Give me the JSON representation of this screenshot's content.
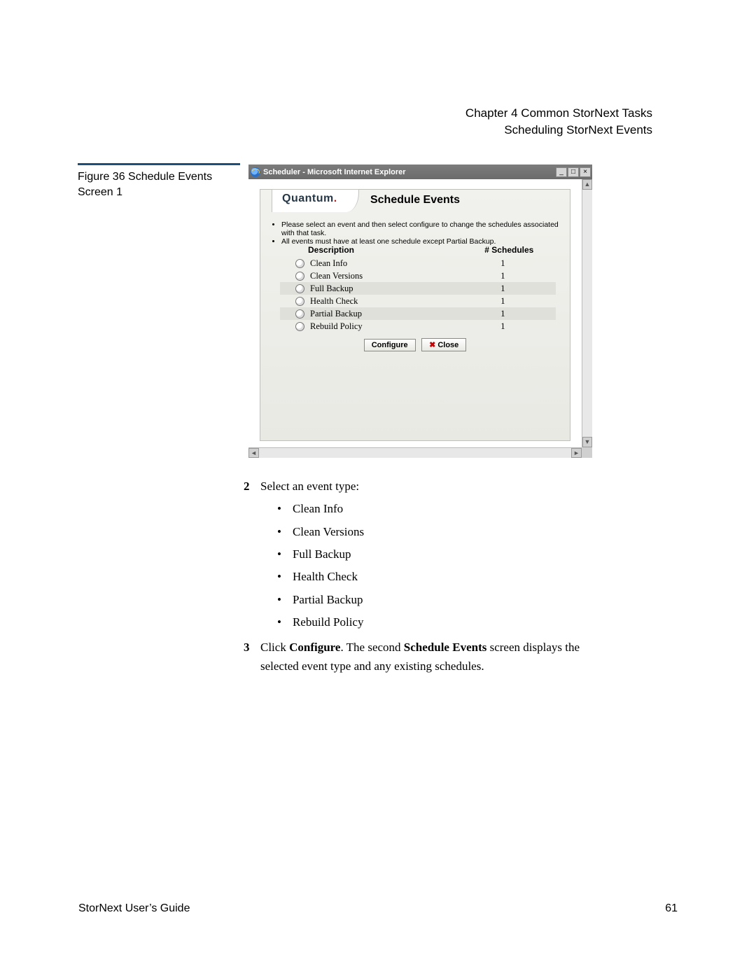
{
  "header": {
    "chapter": "Chapter 4  Common StorNext Tasks",
    "section": "Scheduling StorNext Events"
  },
  "figure": {
    "caption": "Figure 36  Schedule Events Screen 1"
  },
  "window": {
    "title": "Scheduler - Microsoft Internet Explorer",
    "buttons": {
      "min": "_",
      "max": "□",
      "close": "×"
    }
  },
  "scheduler": {
    "brand": "Quantum",
    "panel_title": "Schedule Events",
    "notes": [
      "Please select an event and then select configure to change the schedules associated with that task.",
      "All events must have at least one schedule except Partial Backup."
    ],
    "columns": {
      "description": "Description",
      "count": "# Schedules"
    },
    "rows": [
      {
        "label": "Clean Info",
        "count": "1",
        "alt": false
      },
      {
        "label": "Clean Versions",
        "count": "1",
        "alt": false
      },
      {
        "label": "Full Backup",
        "count": "1",
        "alt": true
      },
      {
        "label": "Health Check",
        "count": "1",
        "alt": false
      },
      {
        "label": "Partial Backup",
        "count": "1",
        "alt": true
      },
      {
        "label": "Rebuild Policy",
        "count": "1",
        "alt": false
      }
    ],
    "buttons": {
      "configure": "Configure",
      "close": "Close"
    }
  },
  "steps": {
    "s2": {
      "num": "2",
      "text": "Select an event type:"
    },
    "s2_items": [
      "Clean Info",
      "Clean Versions",
      "Full Backup",
      "Health Check",
      "Partial Backup",
      "Rebuild Policy"
    ],
    "s3": {
      "num": "3",
      "text_pre": "Click ",
      "bold1": "Configure",
      "text_mid": ". The second ",
      "bold2": "Schedule Events",
      "text_post": " screen displays the selected event type and any existing schedules."
    }
  },
  "footer": {
    "left": "StorNext User’s Guide",
    "right": "61"
  }
}
